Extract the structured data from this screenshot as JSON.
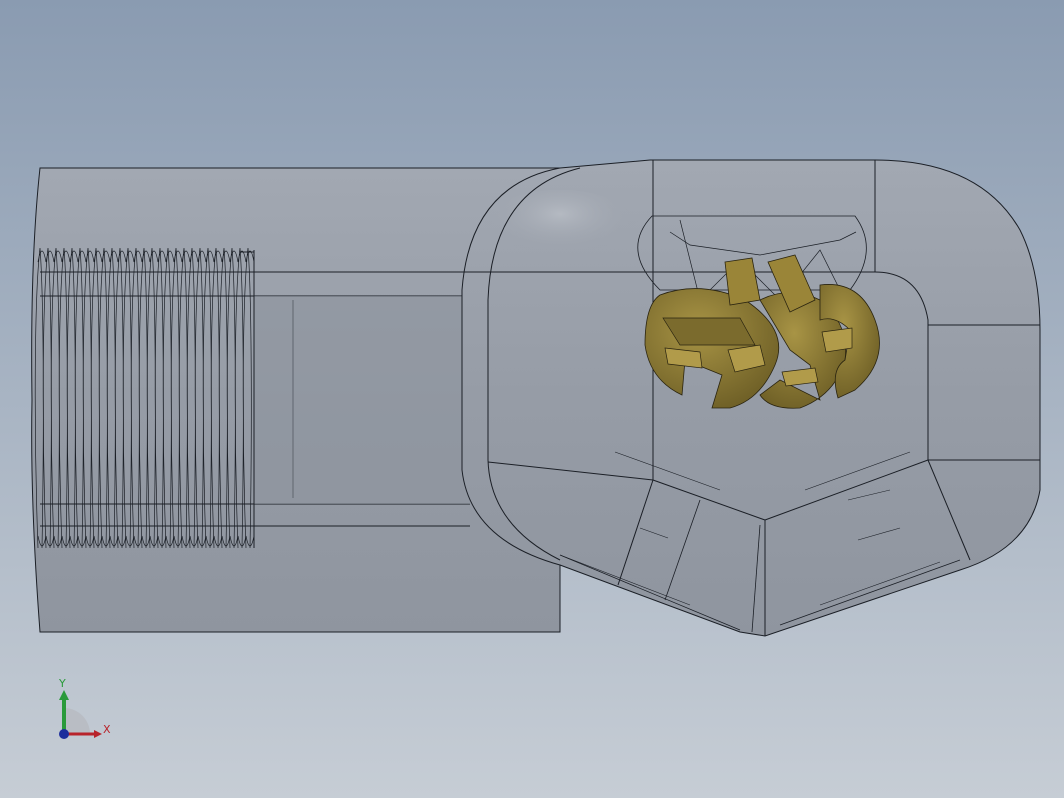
{
  "viewport": {
    "background_top": "#8a9bb1",
    "background_bottom": "#c6cdd5",
    "body_fill": "#9aa0aa",
    "edge_color": "#1b1f26",
    "part_fill": "#8c7a35",
    "part_fill_light": "#a38e40",
    "part_fill_dark": "#6b5c24"
  },
  "triad": {
    "x_label": "X",
    "y_label": "Y",
    "x_color": "#b8232b",
    "y_color": "#2a9a3a",
    "z_color": "#1d2e9c"
  }
}
